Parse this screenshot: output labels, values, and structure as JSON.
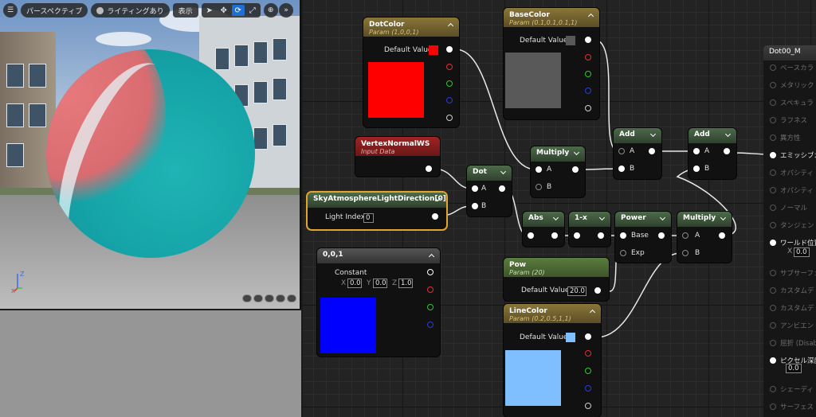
{
  "viewport": {
    "toolbar": {
      "menu_icon": "hamburger-icon",
      "perspective_label": "パースペクティブ",
      "lighting_label": "ライティングあり",
      "show_label": "表示"
    },
    "axis_labels": {
      "z": "Z",
      "x": "X"
    }
  },
  "nodes": {
    "dotcolor": {
      "title": "DotColor",
      "subtitle": "Param (1,0,0,1)",
      "field_label": "Default Value",
      "color": "#ff0000"
    },
    "basecolor": {
      "title": "BaseColor",
      "subtitle": "Param (0.1,0.1,0.1,1)",
      "field_label": "Default Value",
      "color": "#595959"
    },
    "vertexnormal": {
      "title": "VertexNormalWS",
      "subtitle": "Input Data"
    },
    "skyatmo": {
      "title": "SkyAtmosphereLightDirection[0]",
      "field_label": "Light Index",
      "field_value": "0"
    },
    "dot": {
      "title": "Dot",
      "in_a": "A",
      "in_b": "B"
    },
    "multiply1": {
      "title": "Multiply",
      "in_a": "A",
      "in_b": "B"
    },
    "add1": {
      "title": "Add",
      "in_a": "A",
      "in_b": "B"
    },
    "add2": {
      "title": "Add",
      "in_a": "A",
      "in_b": "B"
    },
    "abs": {
      "title": "Abs"
    },
    "oneminus": {
      "title": "1-x"
    },
    "power": {
      "title": "Power",
      "in_base": "Base",
      "in_exp": "Exp"
    },
    "multiply2": {
      "title": "Multiply",
      "in_a": "A",
      "in_b": "B"
    },
    "constant": {
      "title": "0,0,1",
      "field_label": "Constant",
      "x_label": "X",
      "x_value": "0.0",
      "y_label": "Y",
      "y_value": "0.0",
      "z_label": "Z",
      "z_value": "1.0",
      "color": "#0000ff"
    },
    "pow": {
      "title": "Pow",
      "subtitle": "Param (20)",
      "field_label": "Default Value",
      "field_value": "20.0"
    },
    "linecolor": {
      "title": "LineColor",
      "subtitle": "Param (0.2,0.5,1,1)",
      "field_label": "Default Value",
      "color": "#7fbfff"
    }
  },
  "result": {
    "title": "Dot00_M",
    "pins": [
      {
        "label": "ベースカラ",
        "active": false
      },
      {
        "label": "メタリック",
        "active": false
      },
      {
        "label": "スペキュラ",
        "active": false
      },
      {
        "label": "ラフネス",
        "active": false
      },
      {
        "label": "異方性",
        "active": false
      },
      {
        "label": "エミッシブカ",
        "active": true
      },
      {
        "label": "オパシティ",
        "active": false
      },
      {
        "label": "オパシティ",
        "active": false
      },
      {
        "label": "ノーマル",
        "active": false
      },
      {
        "label": "タンジェント",
        "active": false
      },
      {
        "label": "ワールド位置",
        "active": true
      },
      {
        "label": "サブサーフェ",
        "active": false
      },
      {
        "label": "カスタムデ",
        "active": false
      },
      {
        "label": "カスタムデ",
        "active": false
      },
      {
        "label": "アンビエント",
        "active": false
      },
      {
        "label": "屈折 (Disab",
        "active": false
      },
      {
        "label": "ピクセル深度",
        "active": true
      },
      {
        "label": "シェーディ",
        "active": false
      },
      {
        "label": "サーフェス",
        "active": false
      }
    ],
    "world_x_label": "X",
    "world_x_value": "0.0",
    "pixel_depth_value": "0.0"
  }
}
